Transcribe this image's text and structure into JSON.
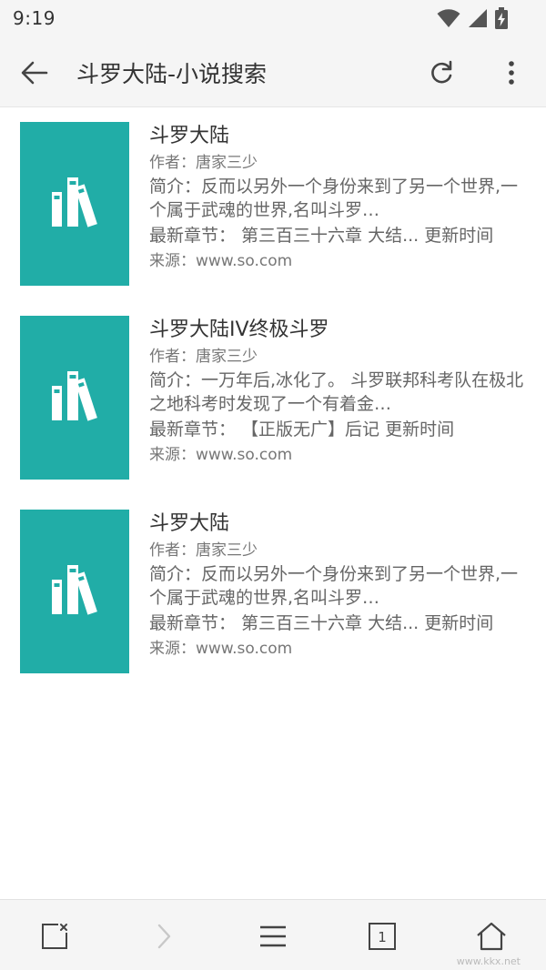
{
  "status_bar": {
    "time": "9:19",
    "icons": [
      "wifi-icon",
      "signal-icon",
      "battery-charging-icon"
    ]
  },
  "app_bar": {
    "title": "斗罗大陆-小说搜索",
    "back_icon": "arrow-left-icon",
    "refresh_icon": "refresh-icon",
    "more_icon": "more-vertical-icon"
  },
  "results": [
    {
      "title": "斗罗大陆",
      "author": "作者：唐家三少",
      "intro": "简介：反而以另外一个身份来到了另一个世界,一个属于武魂的世界,名叫斗罗…",
      "latest": "最新章节： 第三百三十六章 大结... 更新时间",
      "source": "来源：www.so.com"
    },
    {
      "title": "斗罗大陆IV终极斗罗",
      "author": "作者：唐家三少",
      "intro": "简介：一万年后,冰化了。 斗罗联邦科考队在极北之地科考时发现了一个有着金…",
      "latest": "最新章节： 【正版无广】后记 更新时间",
      "source": "来源：www.so.com"
    },
    {
      "title": "斗罗大陆",
      "author": "作者：唐家三少",
      "intro": "简介：反而以另外一个身份来到了另一个世界,一个属于武魂的世界,名叫斗罗…",
      "latest": "最新章节： 第三百三十六章 大结... 更新时间",
      "source": "来源：www.so.com"
    }
  ],
  "cover_color": "#21ada7",
  "bottom_bar": {
    "tab_count": "1",
    "icons": [
      "close-page-icon",
      "forward-icon",
      "menu-icon",
      "tabs-icon",
      "home-icon"
    ]
  },
  "watermark": "www.kkx.net"
}
